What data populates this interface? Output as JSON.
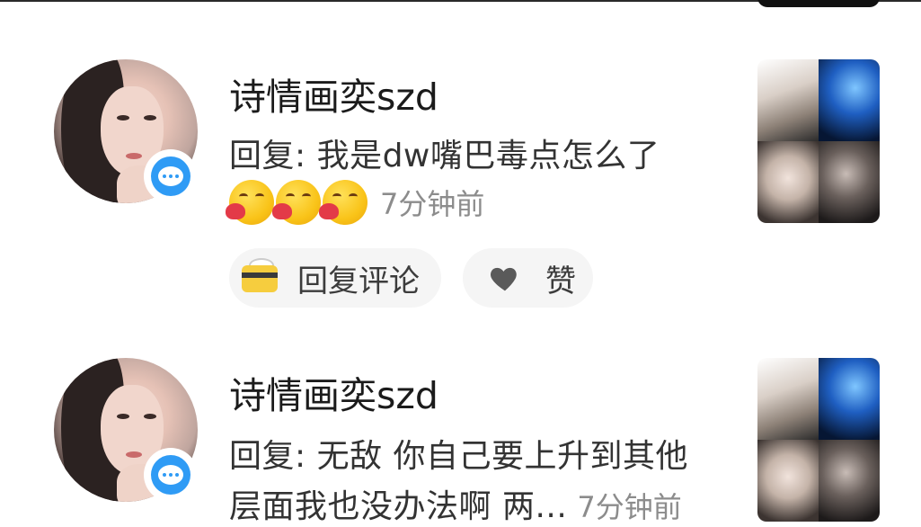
{
  "comments": [
    {
      "username": "诗情画奕szd",
      "reply_text": "回复: 我是dw嘴巴毒点怎么了",
      "reaction_emojis": [
        "kissing-heart-emoji",
        "kissing-heart-emoji",
        "kissing-heart-emoji"
      ],
      "time": "7分钟前",
      "reply_button_label": "回复评论",
      "like_button_label": "赞",
      "badge_icon": "message-bubble-icon"
    },
    {
      "username": "诗情画奕szd",
      "reply_text_line1": "回复: 无敌 你自己要上升到其他",
      "reply_text_line2": "层面我也没办法啊  两...",
      "time": "7分钟前",
      "badge_icon": "message-bubble-icon"
    }
  ],
  "colors": {
    "badge_blue": "#2f9bf5",
    "pill_bg": "#f5f5f5",
    "time_gray": "#8c8c8c"
  }
}
